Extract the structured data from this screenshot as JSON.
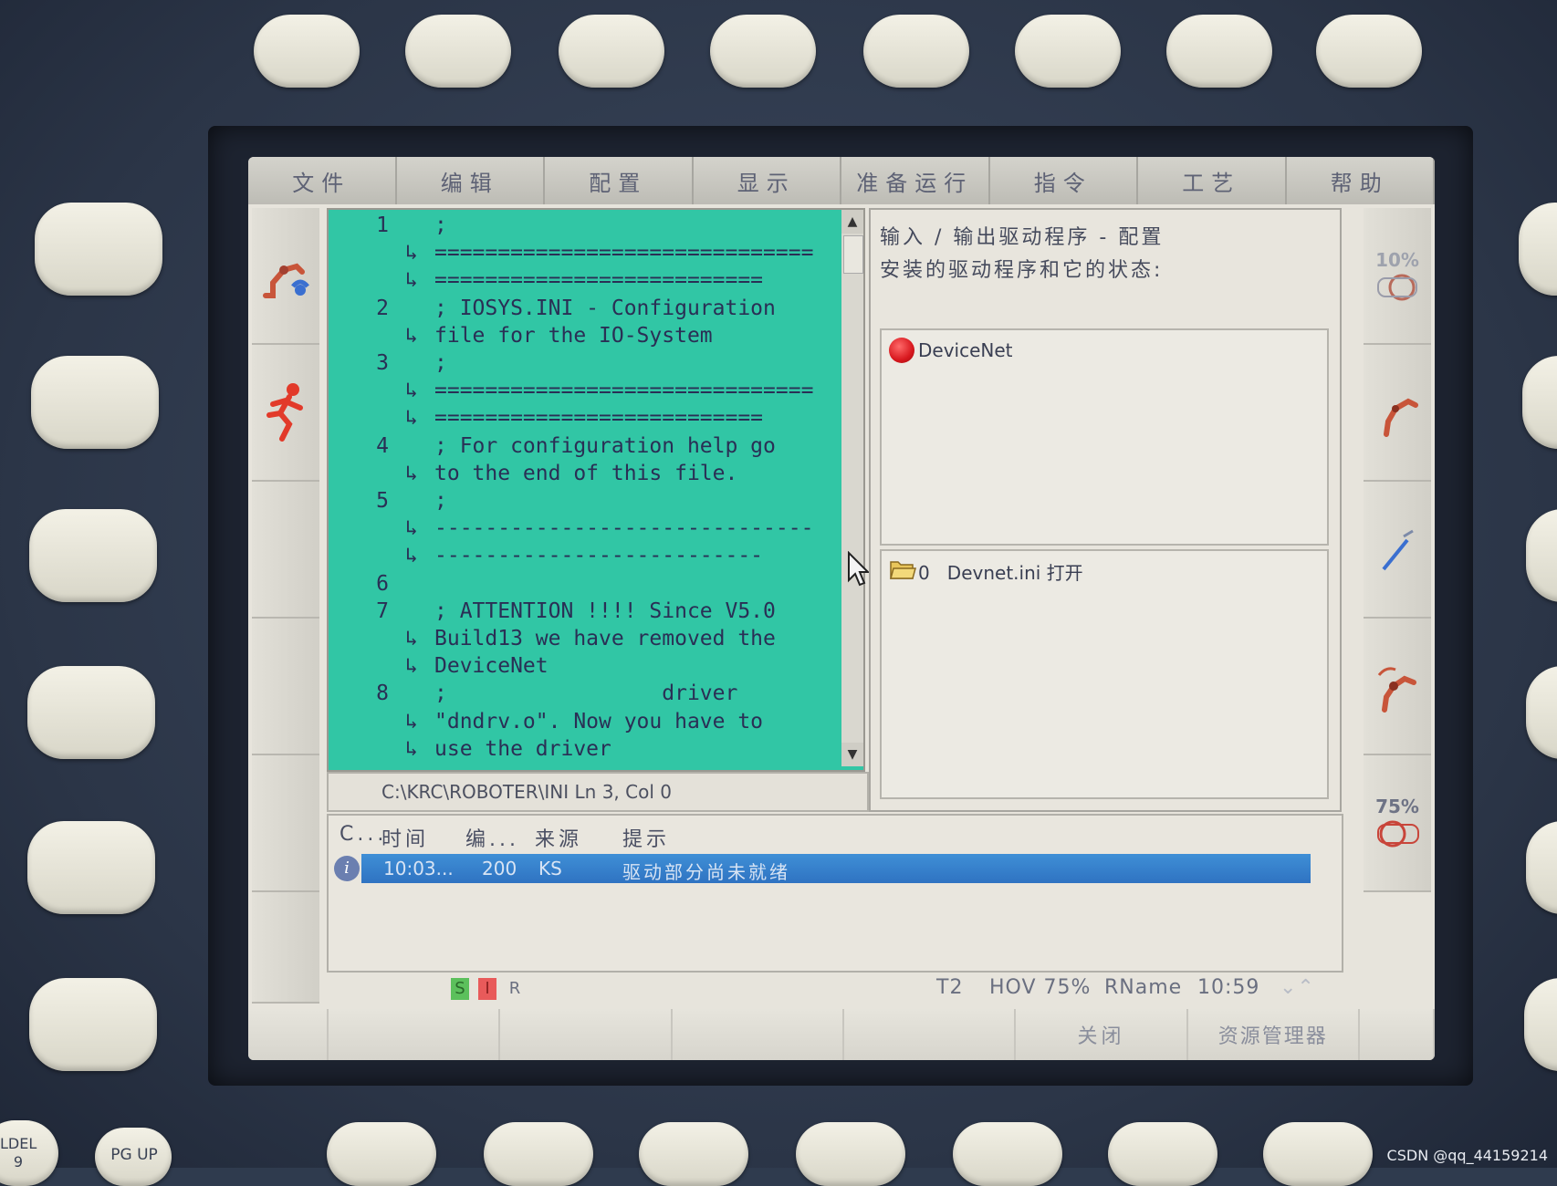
{
  "menu": [
    "文件",
    "编辑",
    "配置",
    "显示",
    "准备运行",
    "指令",
    "工艺",
    "帮助"
  ],
  "editor": {
    "lines": [
      {
        "num": "1",
        "text": ";"
      },
      {
        "num": "",
        "cont": "↳",
        "text": "=============================="
      },
      {
        "num": "",
        "cont": "↳",
        "text": "=========================="
      },
      {
        "num": "2",
        "text": "; IOSYS.INI - Configuration"
      },
      {
        "num": "",
        "cont": "↳",
        "text": "file for the IO-System"
      },
      {
        "num": "3",
        "text": ";"
      },
      {
        "num": "",
        "cont": "↳",
        "text": "=============================="
      },
      {
        "num": "",
        "cont": "↳",
        "text": "=========================="
      },
      {
        "num": "4",
        "text": "; For configuration help go"
      },
      {
        "num": "",
        "cont": "↳",
        "text": "to the end of this file."
      },
      {
        "num": "5",
        "text": ";"
      },
      {
        "num": "",
        "cont": "↳",
        "text": "------------------------------"
      },
      {
        "num": "",
        "cont": "↳",
        "text": "--------------------------"
      },
      {
        "num": "6",
        "text": ""
      },
      {
        "num": "7",
        "text": "; ATTENTION !!!! Since V5.0"
      },
      {
        "num": "",
        "cont": "↳",
        "text": "Build13 we have removed the"
      },
      {
        "num": "",
        "cont": "↳",
        "text": "DeviceNet"
      },
      {
        "num": "8",
        "text": ";                 driver"
      },
      {
        "num": "",
        "cont": "↳",
        "text": "\"dndrv.o\". Now you have to"
      },
      {
        "num": "",
        "cont": "↳",
        "text": "use the driver"
      }
    ],
    "status": "C:\\KRC\\ROBOTER\\INI  Ln 3, Col 0"
  },
  "io_panel": {
    "title": "输入 / 输出驱动程序 - 配置",
    "subtitle": "安装的驱动程序和它的状态:",
    "driver": "DeviceNet",
    "file_entry": "0   Devnet.ini 打开"
  },
  "messages": {
    "headers": [
      "C...",
      "时间",
      "编...",
      "来源",
      "提示"
    ],
    "rows": [
      {
        "time": "10:03...",
        "code": "200",
        "source": "KS",
        "text": "驱动部分尚未就绪"
      }
    ]
  },
  "status_bar": {
    "s": "S",
    "i": "I",
    "r": "R",
    "mode": "T2",
    "hov": "HOV 75%",
    "rname": "RName",
    "time": "10:59"
  },
  "right_side": {
    "top_pct": "10%",
    "bottom_pct": "75%"
  },
  "softkeys": [
    "",
    "",
    "",
    "",
    "",
    "关闭",
    "资源管理器"
  ],
  "hardware": {
    "key_ldel": "LDEL",
    "key_ldel_sub": "9",
    "key_pgup": "PG UP"
  },
  "watermark": "CSDN @qq_44159214",
  "colors": {
    "editor_bg": "#31c6a5",
    "msg_highlight": "#2f73c2",
    "driver_status": "#d8181e"
  }
}
